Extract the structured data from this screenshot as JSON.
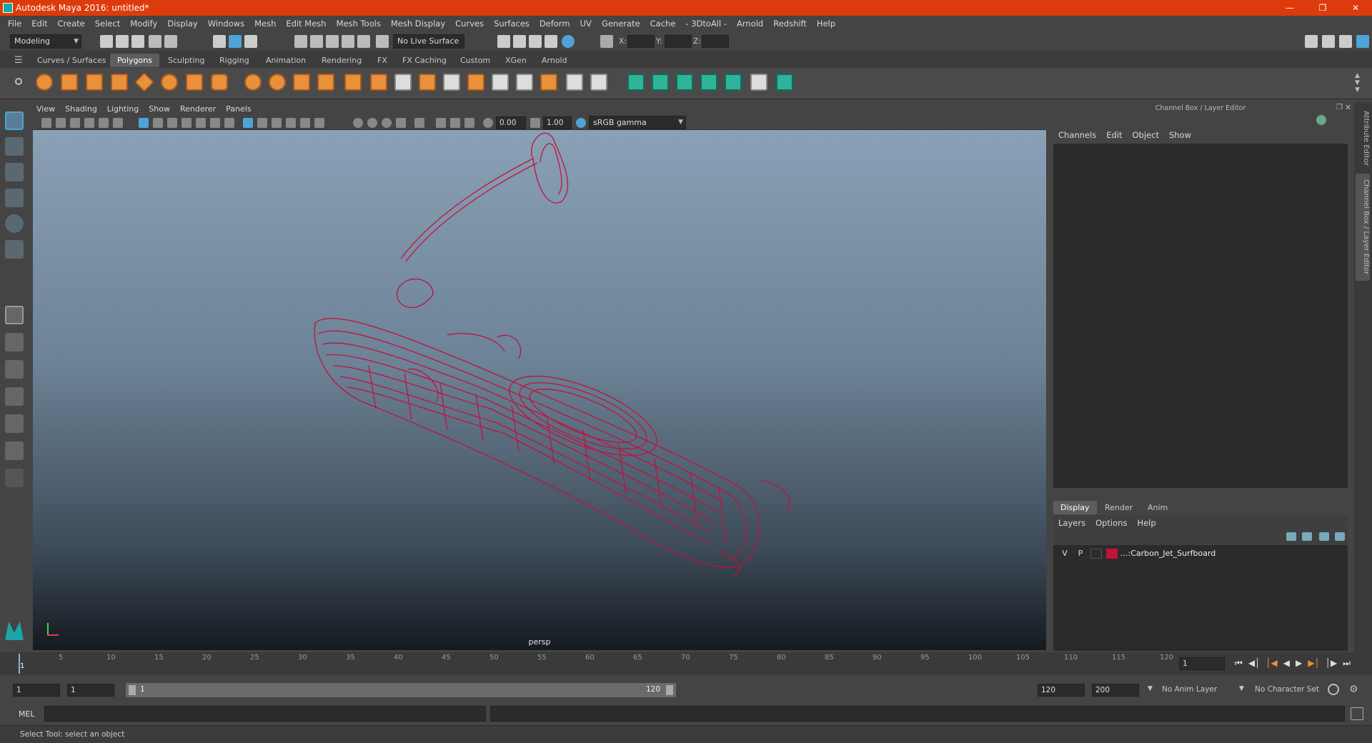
{
  "title": "Autodesk Maya 2016: untitled*",
  "menu": [
    "File",
    "Edit",
    "Create",
    "Select",
    "Modify",
    "Display",
    "Windows",
    "Mesh",
    "Edit Mesh",
    "Mesh Tools",
    "Mesh Display",
    "Curves",
    "Surfaces",
    "Deform",
    "UV",
    "Generate",
    "Cache",
    "- 3DtoAll -",
    "Arnold",
    "Redshift",
    "Help"
  ],
  "status": {
    "mode": "Modeling",
    "live_surface": "No Live Surface",
    "x_label": "X:",
    "y_label": "Y:",
    "z_label": "Z:"
  },
  "shelf_tabs": [
    "Curves / Surfaces",
    "Polygons",
    "Sculpting",
    "Rigging",
    "Animation",
    "Rendering",
    "FX",
    "FX Caching",
    "Custom",
    "XGen",
    "Arnold"
  ],
  "viewport": {
    "menu": [
      "View",
      "Shading",
      "Lighting",
      "Show",
      "Renderer",
      "Panels"
    ],
    "exposure": "0.00",
    "gamma": "1.00",
    "colorspace": "sRGB gamma",
    "camera": "persp"
  },
  "channelbox": {
    "title": "Channel Box / Layer Editor",
    "menu": [
      "Channels",
      "Edit",
      "Object",
      "Show"
    ],
    "tabs": [
      "Display",
      "Render",
      "Anim"
    ],
    "layer_menu": [
      "Layers",
      "Options",
      "Help"
    ],
    "layer": {
      "v": "V",
      "p": "P",
      "name": "...:Carbon_Jet_Surfboard",
      "color": "#c0133d"
    }
  },
  "side_tabs": [
    "Attribute Editor",
    "Channel Box / Layer Editor"
  ],
  "timeline": {
    "ticks": [
      "5",
      "10",
      "15",
      "20",
      "25",
      "30",
      "35",
      "40",
      "45",
      "50",
      "55",
      "60",
      "65",
      "70",
      "75",
      "80",
      "85",
      "90",
      "95",
      "100",
      "105",
      "110",
      "115",
      "120"
    ],
    "start_label": "1",
    "current_frame": "1"
  },
  "range": {
    "start": "1",
    "playback_start": "1",
    "slider_start": "1",
    "slider_end": "120",
    "playback_end": "120",
    "end": "200",
    "anim_layer": "No Anim Layer",
    "char_set": "No Character Set"
  },
  "cmd": {
    "label": "MEL"
  },
  "help_text": "Select Tool: select an object",
  "colors": {
    "title_bar": "#dd3b0b",
    "wireframe": "#c0133d",
    "accent": "#4fa3d6"
  }
}
